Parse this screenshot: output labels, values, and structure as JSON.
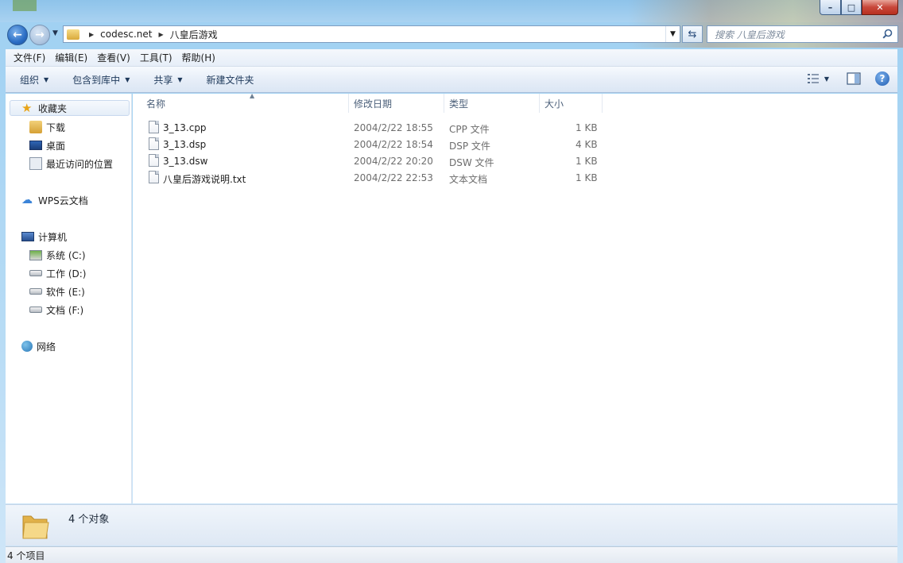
{
  "window": {
    "caption_buttons": {
      "minimize": "–",
      "maximize": "□",
      "close": "✕"
    }
  },
  "address": {
    "crumbs": [
      "codesc.net",
      "八皇后游戏"
    ],
    "search_placeholder": "搜索 八皇后游戏"
  },
  "menu": [
    "文件(F)",
    "编辑(E)",
    "查看(V)",
    "工具(T)",
    "帮助(H)"
  ],
  "toolbar": {
    "organize": "组织",
    "include_in_library": "包含到库中",
    "share": "共享",
    "new_folder": "新建文件夹"
  },
  "navpane": {
    "favorites": "收藏夹",
    "favorites_items": [
      "下载",
      "桌面",
      "最近访问的位置"
    ],
    "wps": "WPS云文档",
    "computer": "计算机",
    "drives": [
      "系统 (C:)",
      "工作 (D:)",
      "软件 (E:)",
      "文档 (F:)"
    ],
    "network": "网络"
  },
  "columns": {
    "name": "名称",
    "date": "修改日期",
    "type": "类型",
    "size": "大小"
  },
  "files": [
    {
      "name": "3_13.cpp",
      "date": "2004/2/22 18:55",
      "type": "CPP 文件",
      "size": "1 KB"
    },
    {
      "name": "3_13.dsp",
      "date": "2004/2/22 18:54",
      "type": "DSP 文件",
      "size": "4 KB"
    },
    {
      "name": "3_13.dsw",
      "date": "2004/2/22 20:20",
      "type": "DSW 文件",
      "size": "1 KB"
    },
    {
      "name": "八皇后游戏说明.txt",
      "date": "2004/2/22 22:53",
      "type": "文本文档",
      "size": "1 KB"
    }
  ],
  "details": {
    "count": "4 个对象"
  },
  "status": {
    "items": "4 个项目"
  }
}
